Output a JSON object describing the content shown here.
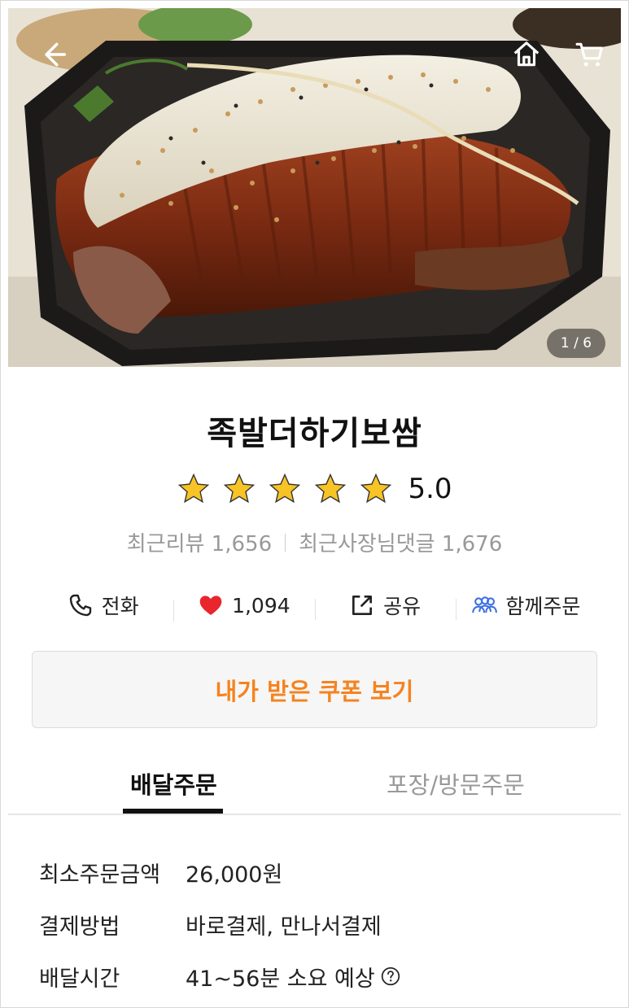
{
  "hero": {
    "counter": "1 / 6",
    "icons": {
      "back": "back-arrow-icon",
      "home": "home-icon",
      "cart": "cart-icon"
    }
  },
  "store": {
    "name": "족발더하기보쌈",
    "rating": 5.0,
    "rating_text": "5.0",
    "stars_filled": 5,
    "recent_reviews": "최근리뷰 1,656",
    "owner_replies": "최근사장님댓글 1,676"
  },
  "actions": {
    "call": "전화",
    "like_count": "1,094",
    "share": "공유",
    "group_order": "함께주문"
  },
  "coupon": {
    "label": "내가 받은 쿠폰 보기",
    "color": "#f5831f"
  },
  "tabs": {
    "delivery": "배달주문",
    "pickup": "포장/방문주문",
    "active": "delivery"
  },
  "details": {
    "min_order_label": "최소주문금액",
    "min_order_value": "26,000원",
    "payment_label": "결제방법",
    "payment_value": "바로결제, 만나서결제",
    "delivery_time_label": "배달시간",
    "delivery_time_value": "41~56분 소요 예상"
  },
  "colors": {
    "star": "#f7c325",
    "heart": "#e8262b",
    "accent": "#f5831f",
    "group_icon": "#3d6fe0"
  }
}
